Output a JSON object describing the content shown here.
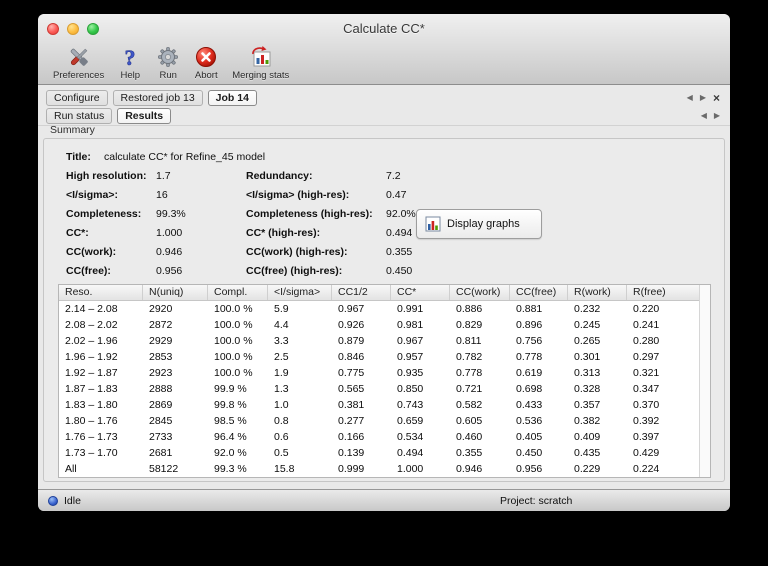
{
  "window": {
    "title": "Calculate CC*"
  },
  "toolbar": {
    "items": [
      {
        "id": "preferences",
        "label": "Preferences",
        "icon": "preferences-tools-icon"
      },
      {
        "id": "help",
        "label": "Help",
        "icon": "help-question-icon"
      },
      {
        "id": "run",
        "label": "Run",
        "icon": "run-gear-icon"
      },
      {
        "id": "abort",
        "label": "Abort",
        "icon": "abort-stop-icon"
      },
      {
        "id": "merging-stats",
        "label": "Merging stats",
        "icon": "merging-stats-chart-icon"
      }
    ]
  },
  "job_tabs": {
    "tabs": [
      {
        "label": "Configure",
        "active": false
      },
      {
        "label": "Restored job 13",
        "active": false
      },
      {
        "label": "Job 14",
        "active": true
      }
    ],
    "nav": {
      "left": "◀",
      "right": "▶",
      "close": "×"
    }
  },
  "result_tabs": {
    "tabs": [
      {
        "label": "Run status",
        "active": false
      },
      {
        "label": "Results",
        "active": true
      }
    ],
    "nav": {
      "left": "◀",
      "right": "▶"
    }
  },
  "section_label": "Summary",
  "summary": {
    "title_label": "Title:",
    "title_value": "calculate CC* for Refine_45 model",
    "rows": [
      {
        "label1": "High resolution:",
        "value1": "1.7",
        "label2": "Redundancy:",
        "value2": "7.2"
      },
      {
        "label1": "<I/sigma>:",
        "value1": "16",
        "label2": "<I/sigma> (high-res):",
        "value2": "0.47"
      },
      {
        "label1": "Completeness:",
        "value1": "99.3%",
        "label2": "Completeness (high-res):",
        "value2": "92.0%"
      },
      {
        "label1": "CC*:",
        "value1": "1.000",
        "label2": "CC* (high-res):",
        "value2": "0.494"
      },
      {
        "label1": "CC(work):",
        "value1": "0.946",
        "label2": "CC(work) (high-res):",
        "value2": "0.355"
      },
      {
        "label1": "CC(free):",
        "value1": "0.956",
        "label2": "CC(free) (high-res):",
        "value2": "0.450"
      }
    ],
    "display_graphs_label": "Display graphs"
  },
  "table": {
    "columns": [
      "Reso.",
      "N(uniq)",
      "Compl.",
      "<I/sigma>",
      "CC1/2",
      "CC*",
      "CC(work)",
      "CC(free)",
      "R(work)",
      "R(free)"
    ],
    "rows": [
      [
        "2.14 – 2.08",
        "2920",
        "100.0 %",
        "5.9",
        "0.967",
        "0.991",
        "0.886",
        "0.881",
        "0.232",
        "0.220"
      ],
      [
        "2.08 – 2.02",
        "2872",
        "100.0 %",
        "4.4",
        "0.926",
        "0.981",
        "0.829",
        "0.896",
        "0.245",
        "0.241"
      ],
      [
        "2.02 – 1.96",
        "2929",
        "100.0 %",
        "3.3",
        "0.879",
        "0.967",
        "0.811",
        "0.756",
        "0.265",
        "0.280"
      ],
      [
        "1.96 – 1.92",
        "2853",
        "100.0 %",
        "2.5",
        "0.846",
        "0.957",
        "0.782",
        "0.778",
        "0.301",
        "0.297"
      ],
      [
        "1.92 – 1.87",
        "2923",
        "100.0 %",
        "1.9",
        "0.775",
        "0.935",
        "0.778",
        "0.619",
        "0.313",
        "0.321"
      ],
      [
        "1.87 – 1.83",
        "2888",
        "99.9 %",
        "1.3",
        "0.565",
        "0.850",
        "0.721",
        "0.698",
        "0.328",
        "0.347"
      ],
      [
        "1.83 – 1.80",
        "2869",
        "99.8 %",
        "1.0",
        "0.381",
        "0.743",
        "0.582",
        "0.433",
        "0.357",
        "0.370"
      ],
      [
        "1.80 – 1.76",
        "2845",
        "98.5 %",
        "0.8",
        "0.277",
        "0.659",
        "0.605",
        "0.536",
        "0.382",
        "0.392"
      ],
      [
        "1.76 – 1.73",
        "2733",
        "96.4 %",
        "0.6",
        "0.166",
        "0.534",
        "0.460",
        "0.405",
        "0.409",
        "0.397"
      ],
      [
        "1.73 – 1.70",
        "2681",
        "92.0 %",
        "0.5",
        "0.139",
        "0.494",
        "0.355",
        "0.450",
        "0.435",
        "0.429"
      ],
      [
        "All",
        "58122",
        "99.3 %",
        "15.8",
        "0.999",
        "1.000",
        "0.946",
        "0.956",
        "0.229",
        "0.224"
      ]
    ]
  },
  "status_bar": {
    "status": "Idle",
    "project": "Project: scratch"
  }
}
